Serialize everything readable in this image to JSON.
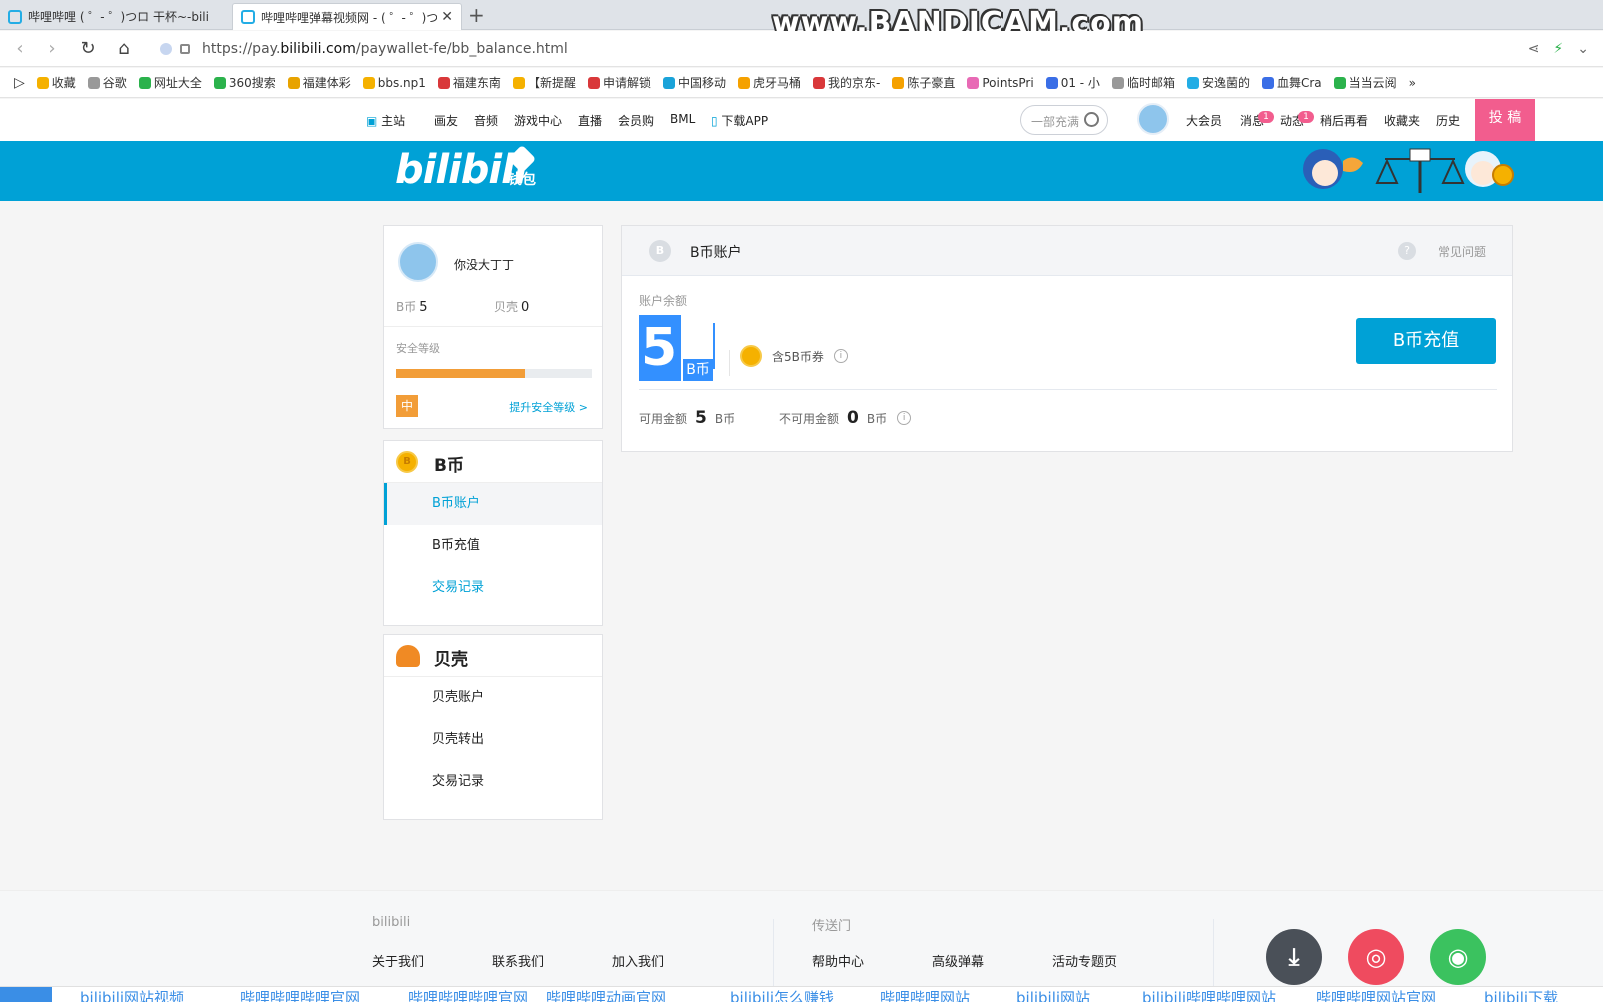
{
  "browser": {
    "tabs": [
      {
        "title": "哔哩哔哩 ( ゜- ゜)つロ 干杯~-bili"
      },
      {
        "title": "哔哩哔哩弹幕视频网 - ( ゜- ゜)つ"
      }
    ],
    "watermark": "www.BANDICAM.com",
    "url_prefix": "https://pay.",
    "url_domain": "bilibili.com",
    "url_path": "/paywallet-fe/bb_balance.html",
    "bookmarks": [
      {
        "label": "收藏",
        "color": "#f5b100"
      },
      {
        "label": "谷歌",
        "color": "#999999"
      },
      {
        "label": "网址大全",
        "color": "#2bb24c"
      },
      {
        "label": "360搜索",
        "color": "#2bb24c"
      },
      {
        "label": "福建体彩",
        "color": "#e8a300"
      },
      {
        "label": "bbs.np1",
        "color": "#f5b100"
      },
      {
        "label": "福建东南",
        "color": "#d9383a"
      },
      {
        "label": "【新提醒",
        "color": "#f5b100"
      },
      {
        "label": "申请解锁",
        "color": "#d9383a"
      },
      {
        "label": "中国移动",
        "color": "#1aa3d9"
      },
      {
        "label": "虎牙马桶",
        "color": "#f5a100"
      },
      {
        "label": "我的京东-",
        "color": "#d9383a"
      },
      {
        "label": "陈子豪直",
        "color": "#f5a100"
      },
      {
        "label": "PointsPri",
        "color": "#e86ab5"
      },
      {
        "label": "01 - 小",
        "color": "#3a6ee6"
      },
      {
        "label": "临时邮箱",
        "color": "#999999"
      },
      {
        "label": "安逸菌的",
        "color": "#23ade5"
      },
      {
        "label": "血舞Cra",
        "color": "#3a6ee6"
      },
      {
        "label": "当当云阅",
        "color": "#2bb24c"
      }
    ]
  },
  "topnav": {
    "left": [
      "主站",
      "画友",
      "音频",
      "游戏中心",
      "直播",
      "会员购",
      "BML",
      "下载APP"
    ],
    "search_placeholder": "一部充满",
    "right": [
      "大会员",
      "消息",
      "动态",
      "稍后再看",
      "收藏夹",
      "历史"
    ],
    "msg_badge": "1",
    "dyn_badge": "1",
    "upload": "投 稿"
  },
  "banner": {
    "logo": "bilibili",
    "wallet": "钱包"
  },
  "user": {
    "name": "你没大丁丁",
    "bcoin_label": "B币",
    "bcoin": "5",
    "shell_label": "贝壳",
    "shell": "0",
    "security_label": "安全等级",
    "security_progress": 0.66,
    "security_level": "中",
    "security_upgrade": "提升安全等级 >"
  },
  "menu_bcoin": {
    "title": "B币",
    "items": [
      "B币账户",
      "B币充值",
      "交易记录"
    ]
  },
  "menu_shell": {
    "title": "贝壳",
    "items": [
      "贝壳账户",
      "贝壳转出",
      "交易记录"
    ]
  },
  "panel": {
    "title": "B币账户",
    "faq": "常见问题",
    "balance_label": "账户余额",
    "balance": "5",
    "unit": "B币",
    "coupon": "含5B币券",
    "available_label": "可用金额",
    "available": "5",
    "unavailable_label": "不可用金额",
    "unavailable": "0",
    "recharge_button": "B币充值"
  },
  "footer": {
    "col1_title": "bilibili",
    "col1_links": [
      "关于我们",
      "联系我们",
      "加入我们"
    ],
    "col2_title": "传送门",
    "col2_links": [
      "帮助中心",
      "高级弹幕",
      "活动专题页"
    ]
  },
  "tagbar": [
    "bilibili网站视频",
    "哔哩哔哩哔哩官网",
    "哔哩哔哩哔哩官网",
    "哔哩哔哩动画官网",
    "bilibili怎么赚钱",
    "哔哩哔哩网站",
    "bilibili网站",
    "bilibili哔哩哔哩网站",
    "哔哩哔哩网站官网",
    "bilibili下载"
  ]
}
